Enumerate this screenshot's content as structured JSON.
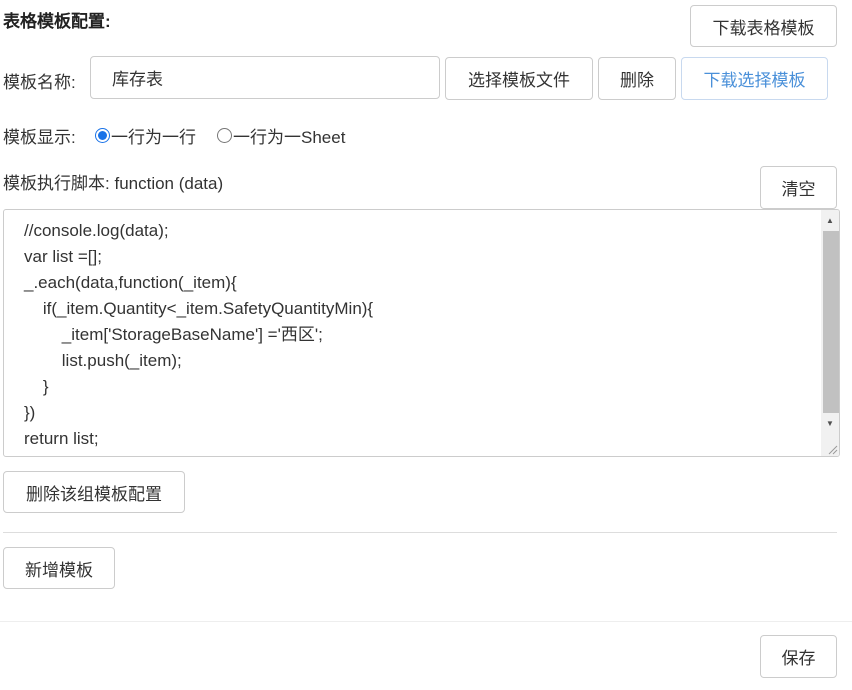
{
  "section": {
    "title": "表格模板配置:",
    "download_table_template": "下载表格模板"
  },
  "template_name": {
    "label": "模板名称:",
    "value": "库存表",
    "select_file": "选择模板文件",
    "delete": "删除",
    "download_selected": "下载选择模板"
  },
  "display": {
    "label": "模板显示:",
    "options": [
      {
        "label": "一行为一行",
        "checked": true
      },
      {
        "label": "一行为一Sheet",
        "checked": false
      }
    ]
  },
  "script": {
    "label": "模板执行脚本:",
    "signature": "function (data)",
    "clear": "清空",
    "code": "//console.log(data);\nvar list =[];\n_.each(data,function(_item){\n    if(_item.Quantity<_item.SafetyQuantityMin){\n        _item['StorageBaseName'] ='西区';\n        list.push(_item);\n    }\n})\nreturn list;"
  },
  "actions": {
    "delete_group": "删除该组模板配置",
    "add_template": "新增模板",
    "save": "保存"
  },
  "colors": {
    "link": "#4a90d9",
    "radio_accent": "#1a73e8",
    "border": "#cccccc"
  }
}
